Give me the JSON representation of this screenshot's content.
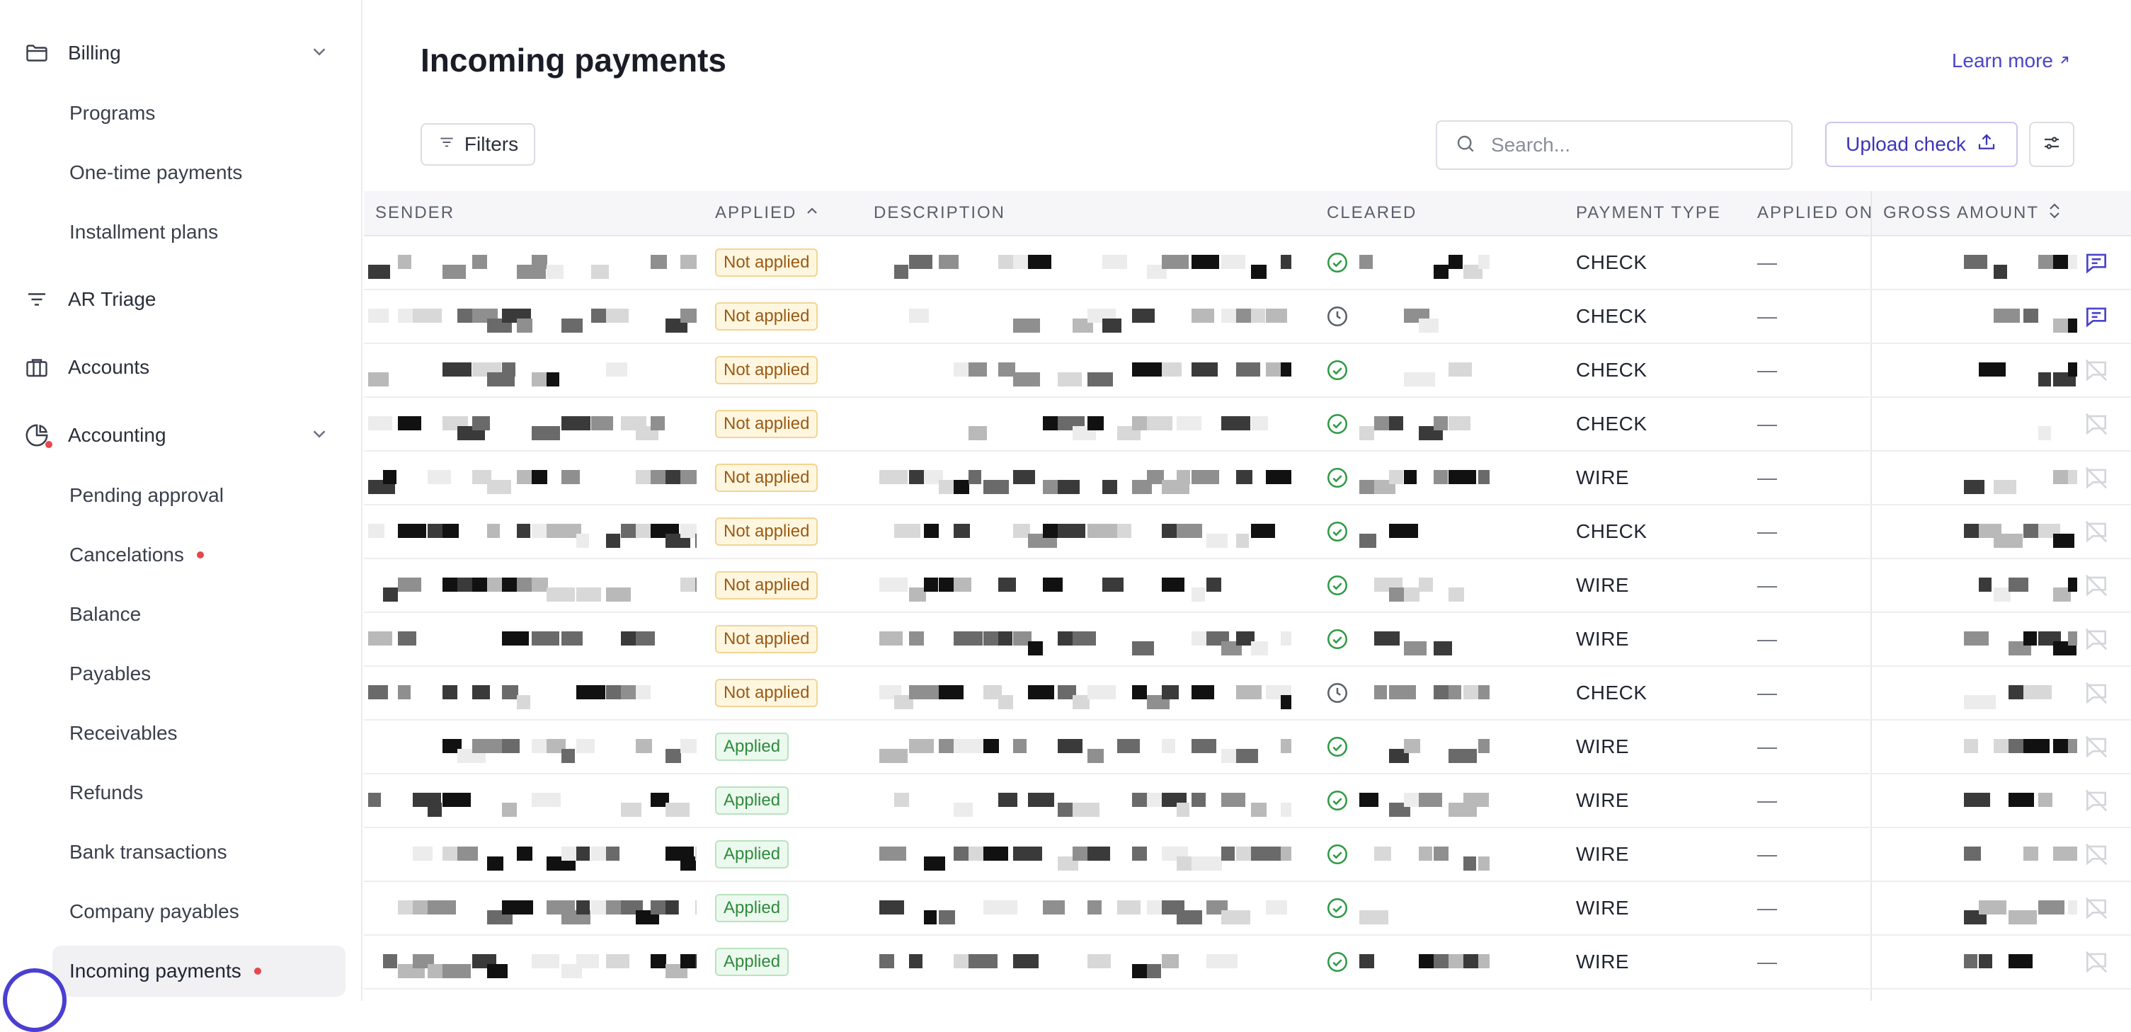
{
  "sidebar": {
    "billing": {
      "label": "Billing",
      "icon": "folder-icon"
    },
    "billing_items": [
      "Programs",
      "One-time payments",
      "Installment plans"
    ],
    "ar_triage": {
      "label": "AR Triage",
      "icon": "filter-lines-icon"
    },
    "accounts": {
      "label": "Accounts",
      "icon": "briefcase-icon"
    },
    "accounting": {
      "label": "Accounting",
      "icon": "pie-chart-icon"
    },
    "accounting_items": [
      "Pending approval",
      "Cancelations",
      "Balance",
      "Payables",
      "Receivables",
      "Refunds",
      "Bank transactions",
      "Company payables",
      "Incoming payments"
    ],
    "active_item": "Incoming payments",
    "dot_color": "#e5484d"
  },
  "page": {
    "title": "Incoming payments",
    "learn_more": "Learn more"
  },
  "toolbar": {
    "filters_label": "Filters",
    "search_placeholder": "Search...",
    "upload_label": "Upload check"
  },
  "table": {
    "columns": [
      "SENDER",
      "APPLIED",
      "DESCRIPTION",
      "CLEARED",
      "PAYMENT TYPE",
      "APPLIED ON",
      "GROSS AMOUNT"
    ],
    "rows": [
      {
        "applied": "Not applied",
        "cleared": "check",
        "payment_type": "CHECK",
        "applied_on": "—",
        "note": "active"
      },
      {
        "applied": "Not applied",
        "cleared": "clock",
        "payment_type": "CHECK",
        "applied_on": "—",
        "note": "active"
      },
      {
        "applied": "Not applied",
        "cleared": "check",
        "payment_type": "CHECK",
        "applied_on": "—",
        "note": "muted"
      },
      {
        "applied": "Not applied",
        "cleared": "check",
        "payment_type": "CHECK",
        "applied_on": "—",
        "note": "muted"
      },
      {
        "applied": "Not applied",
        "cleared": "check",
        "payment_type": "WIRE",
        "applied_on": "—",
        "note": "muted"
      },
      {
        "applied": "Not applied",
        "cleared": "check",
        "payment_type": "CHECK",
        "applied_on": "—",
        "note": "muted"
      },
      {
        "applied": "Not applied",
        "cleared": "check",
        "payment_type": "WIRE",
        "applied_on": "—",
        "note": "muted"
      },
      {
        "applied": "Not applied",
        "cleared": "check",
        "payment_type": "WIRE",
        "applied_on": "—",
        "note": "muted"
      },
      {
        "applied": "Not applied",
        "cleared": "clock",
        "payment_type": "CHECK",
        "applied_on": "—",
        "note": "muted"
      },
      {
        "applied": "Applied",
        "cleared": "check",
        "payment_type": "WIRE",
        "applied_on": "—",
        "note": "muted"
      },
      {
        "applied": "Applied",
        "cleared": "check",
        "payment_type": "WIRE",
        "applied_on": "—",
        "note": "muted"
      },
      {
        "applied": "Applied",
        "cleared": "check",
        "payment_type": "WIRE",
        "applied_on": "—",
        "note": "muted"
      },
      {
        "applied": "Applied",
        "cleared": "check",
        "payment_type": "WIRE",
        "applied_on": "—",
        "note": "muted"
      },
      {
        "applied": "Applied",
        "cleared": "check",
        "payment_type": "WIRE",
        "applied_on": "—",
        "note": "muted"
      }
    ]
  },
  "colors": {
    "accent": "#4b45c6",
    "not_applied_text": "#9a5a12",
    "applied_text": "#2f8a3d",
    "cleared_green": "#2f9a45"
  }
}
